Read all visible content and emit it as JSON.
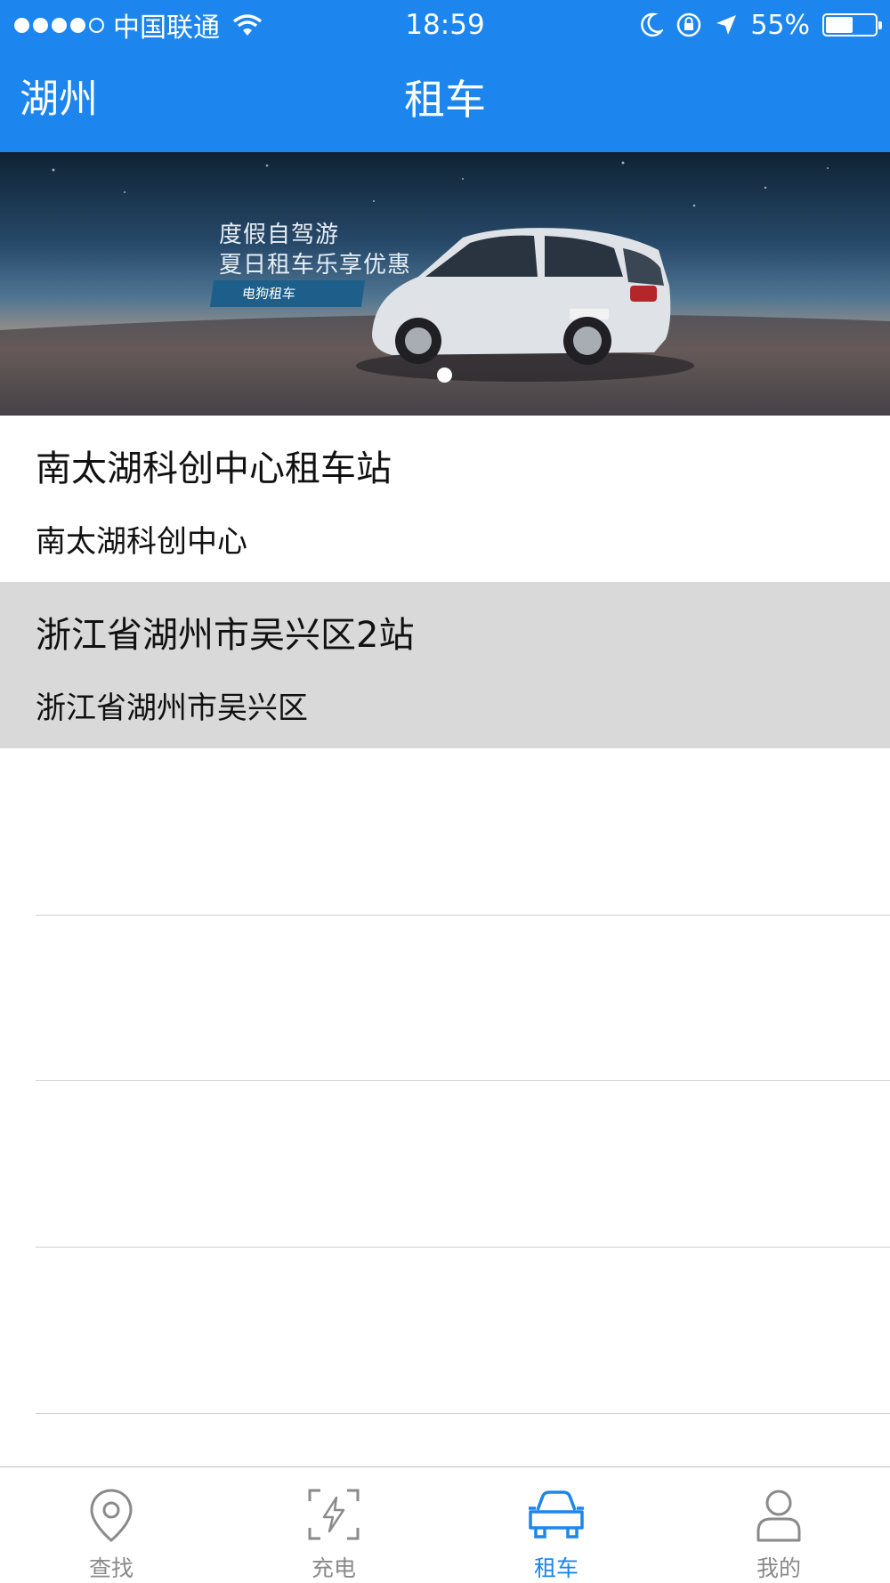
{
  "statusbar": {
    "carrier": "中国联通",
    "time": "18:59",
    "battery_text": "55%",
    "battery_level": 0.55
  },
  "nav": {
    "city": "湖州",
    "title": "租车"
  },
  "banner": {
    "line1": "度假自驾游",
    "line2": "夏日租车乐享优惠",
    "tag": "电狗租车",
    "pages": 1,
    "active_page": 1
  },
  "stations": [
    {
      "name": "南太湖科创中心租车站",
      "address": "南太湖科创中心"
    },
    {
      "name": "浙江省湖州市吴兴区2站",
      "address": "浙江省湖州市吴兴区"
    }
  ],
  "tabs": [
    {
      "label": "查找",
      "icon": "location-pin-icon",
      "active": false
    },
    {
      "label": "充电",
      "icon": "charging-icon",
      "active": false
    },
    {
      "label": "租车",
      "icon": "car-icon",
      "active": true
    },
    {
      "label": "我的",
      "icon": "user-icon",
      "active": false
    }
  ],
  "colors": {
    "primary": "#1C85EE",
    "selected_row": "#D9D9D9",
    "tab_inactive": "#8A8A8A"
  }
}
